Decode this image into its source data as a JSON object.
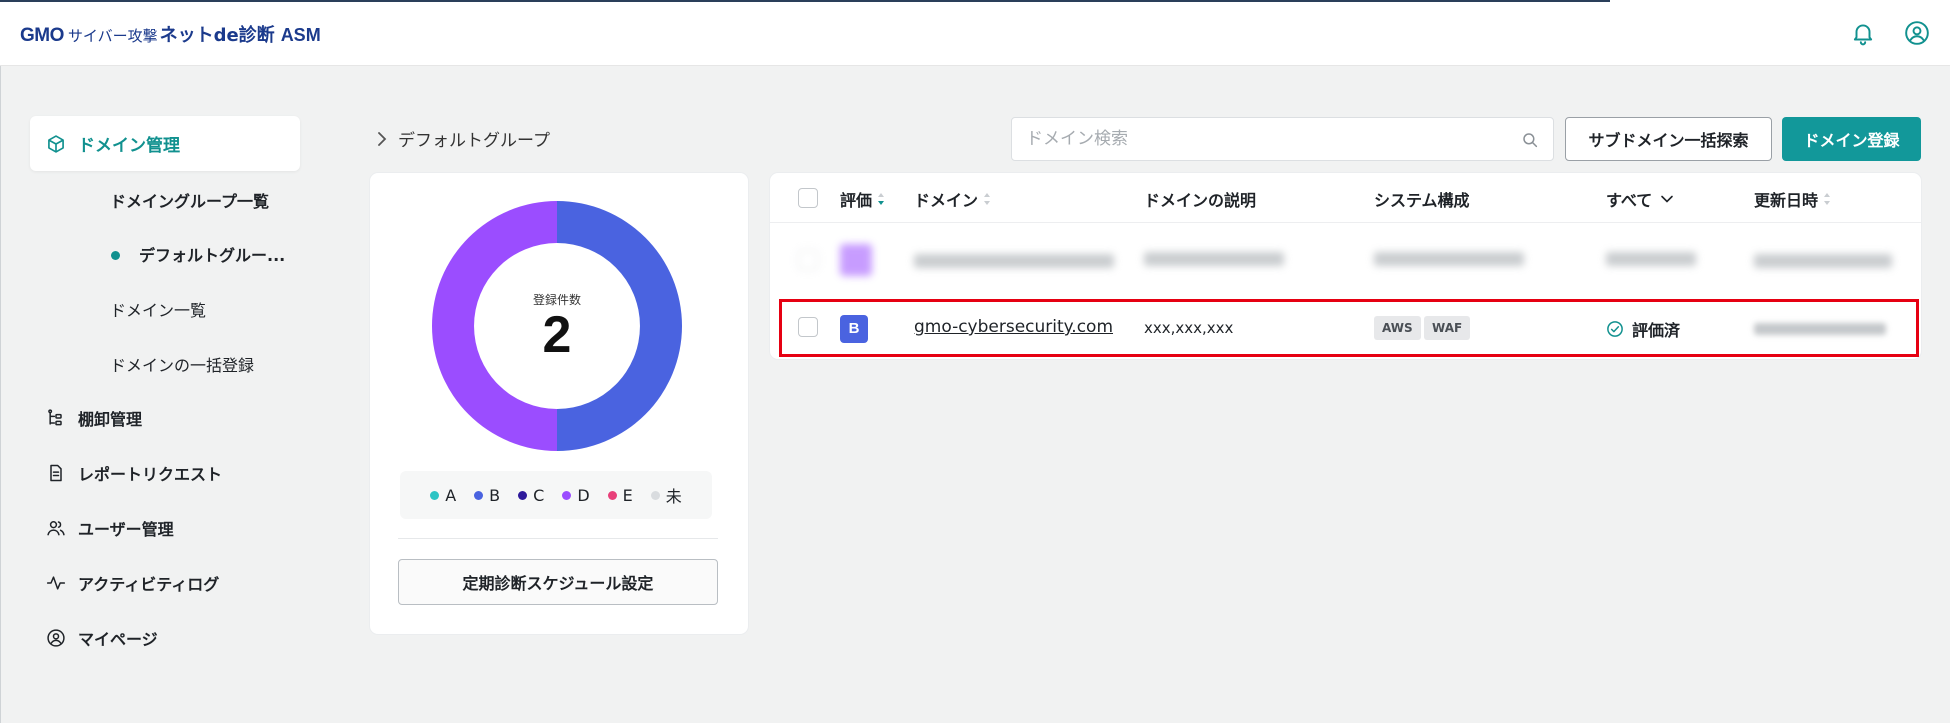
{
  "app": {
    "logo_gmo": "GMO",
    "logo_sub": "サイバー攻撃",
    "logo_main": "ネットde診断",
    "logo_asm": "ASM"
  },
  "header_icons": [
    "bell-icon",
    "user-circle-icon"
  ],
  "sidebar": {
    "active": {
      "label": "ドメイン管理",
      "icon": "cube-icon"
    },
    "sub_items": [
      {
        "label": "ドメイングループ一覧"
      },
      {
        "label": "デフォルトグルー..."
      },
      {
        "label": "ドメイン一覧"
      },
      {
        "label": "ドメインの一括登録"
      }
    ],
    "items": [
      {
        "label": "棚卸管理",
        "icon": "tree-icon"
      },
      {
        "label": "レポートリクエスト",
        "icon": "document-icon"
      },
      {
        "label": "ユーザー管理",
        "icon": "users-icon"
      },
      {
        "label": "アクティビティログ",
        "icon": "activity-icon"
      },
      {
        "label": "マイページ",
        "icon": "user-circle-icon"
      }
    ]
  },
  "breadcrumb": {
    "label": "デフォルトグループ"
  },
  "search": {
    "placeholder": "ドメイン検索"
  },
  "buttons": {
    "subdomain_search": "サブドメイン一括探索",
    "register_domain": "ドメイン登録",
    "schedule": "定期診断スケジュール設定"
  },
  "summary": {
    "label": "登録件数",
    "count": "2"
  },
  "chart_data": {
    "type": "pie",
    "categories": [
      "B",
      "D"
    ],
    "values": [
      1,
      1
    ],
    "colors": [
      "#4a63e0",
      "#9b4dff"
    ],
    "legend": [
      {
        "label": "A",
        "color": "#2ec4c4"
      },
      {
        "label": "B",
        "color": "#4a63e0"
      },
      {
        "label": "C",
        "color": "#2e1a9b"
      },
      {
        "label": "D",
        "color": "#9b4dff"
      },
      {
        "label": "E",
        "color": "#e8407a"
      },
      {
        "label": "未",
        "color": "#d9dcdf"
      }
    ]
  },
  "table": {
    "columns": [
      {
        "label": "評価"
      },
      {
        "label": "ドメイン"
      },
      {
        "label": "ドメインの説明"
      },
      {
        "label": "システム構成"
      },
      {
        "label": "すべて"
      },
      {
        "label": "更新日時"
      }
    ],
    "rows": [
      {
        "rating": "B",
        "domain": "gmo-cybersecurity.com",
        "description": "xxx,xxx,xxx",
        "tags": [
          "AWS",
          "WAF"
        ],
        "status": "評価済"
      }
    ]
  },
  "colors": {
    "accent": "#12989a",
    "highlight": "#e60012"
  }
}
